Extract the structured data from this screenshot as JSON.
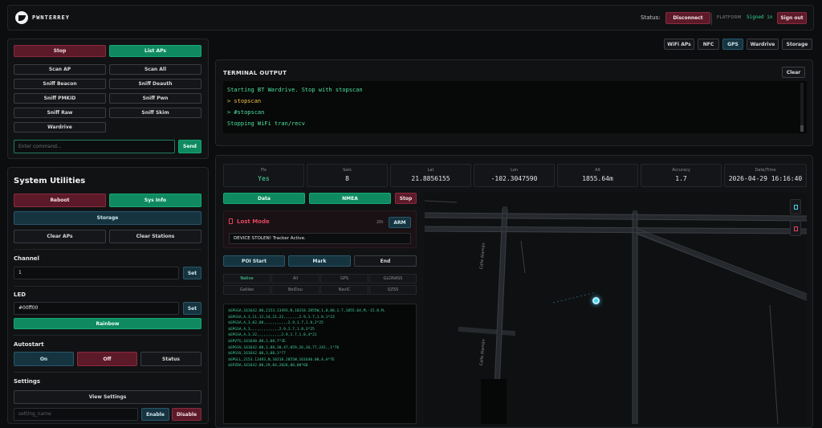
{
  "header": {
    "brand": "PWNTERREY",
    "status_label": "Status:",
    "disconnect_label": "Disconnect",
    "platform_label": "PLATFORM",
    "signed_in_label": "Signed in",
    "sign_out_label": "Sign out"
  },
  "wifi_panel": {
    "buttons": [
      "Stop",
      "List APs",
      "Scan AP",
      "Scan All",
      "Sniff Beacon",
      "Sniff Deauth",
      "Sniff PMKID",
      "Sniff Pwn",
      "Sniff Raw",
      "Sniff Skim",
      "Wardrive"
    ],
    "command_placeholder": "Enter command...",
    "send_label": "Send"
  },
  "system": {
    "title": "System Utilities",
    "reboot_label": "Reboot",
    "sysinfo_label": "Sys Info",
    "storage_label": "Storage",
    "clear_aps_label": "Clear APs",
    "clear_stations_label": "Clear Stations",
    "channel_label": "Channel",
    "channel_value": "1",
    "set_label": "Set",
    "led_label": "LED",
    "led_value": "#00ff00",
    "rainbow_label": "Rainbow",
    "autostart_label": "Autostart",
    "on_label": "On",
    "off_label": "Off",
    "status_label": "Status",
    "settings_label": "Settings",
    "view_settings_label": "View Settings",
    "setting_placeholder": "setting_name",
    "enable_label": "Enable",
    "disable_label": "Disable"
  },
  "top_tabs": [
    "WiFi APs",
    "NFC",
    "GPS",
    "Wardrive",
    "Storage"
  ],
  "terminal": {
    "title": "TERMINAL OUTPUT",
    "clear_label": "Clear",
    "lines": [
      {
        "text": "Starting BT Wardrive. Stop with stopscan",
        "color": "#4be3a0"
      },
      {
        "text": "> stopscan",
        "color": "#f0c24a"
      },
      {
        "text": "> #stopscan",
        "color": "#4be3a0"
      },
      {
        "text": "Stopping WiFi tran/recv",
        "color": "#4be3a0"
      }
    ]
  },
  "gps": {
    "stats": [
      {
        "title": "Fix",
        "value": "Yes",
        "color": "#4be3a0"
      },
      {
        "title": "Sats",
        "value": "8",
        "color": "#e6e6e6"
      },
      {
        "title": "Lat",
        "value": "21.8856155",
        "color": "#e6e6e6"
      },
      {
        "title": "Lon",
        "value": "-102.3047590",
        "color": "#e6e6e6"
      },
      {
        "title": "Alt",
        "value": "1855.64m",
        "color": "#e6e6e6"
      },
      {
        "title": "Accuracy",
        "value": "1.7",
        "color": "#e6e6e6"
      },
      {
        "title": "Date/Time",
        "value": "2026-04-29 16:16:40",
        "color": "#e6e6e6"
      }
    ],
    "data_label": "Data",
    "nmea_label": "NMEA",
    "stop_label": "Stop",
    "lost_mode_title": "Lost Mode",
    "lost_mode_count": "20t",
    "arm_label": "ARM",
    "lost_message": "DEVICE STOLEN! Tracker Active.",
    "poi_start_label": "POI Start",
    "mark_label": "Mark",
    "end_label": "End",
    "nmea_tabs": [
      "Native",
      "All",
      "GPS",
      "GLONASS",
      "Galileo",
      "BeiDou",
      "NavIC",
      "QZSS"
    ],
    "nmea_lines": [
      "$GPGGA,161642.00,2153.13493,N,10218.2855W,1,8,08,1.7,1855.64,M,-15.0,M,",
      "$GPGSA,A,3,11,12,14,21,22,,,,,,,2.9,1.7,1.8,1*23",
      "$GPGSA,A,3,02,08,,,,,,,,,,,2.9,1.7,1.8,2*25",
      "$GPGSA,A,3,,,,,,,,,,,,,2.9,1.7,1.8,3*25",
      "$GPGSA,A,3,32,,,,,,,,,,,2.9,1.7,1.8,4*21",
      "$GPVTG,161640.00,1,08,7*3E",
      "$GPGSV,161642.00,1,08,30,47,059,26,36,77,242,,1*76",
      "$GPGSV,161642.00,3,08,1*77",
      "$GPGLL,2153.13493,N,10218.2855W,161640.00,A,A*7E",
      "$GPZDA,161642.00,29,04,2026,00,00*6D"
    ]
  },
  "map": {
    "street1": "Calle Alamán",
    "street2": "Calle Alamán"
  },
  "colors": {
    "accent_green": "#0f8a60",
    "accent_red": "#5c1a29",
    "terminal_green": "#4be3a0"
  }
}
